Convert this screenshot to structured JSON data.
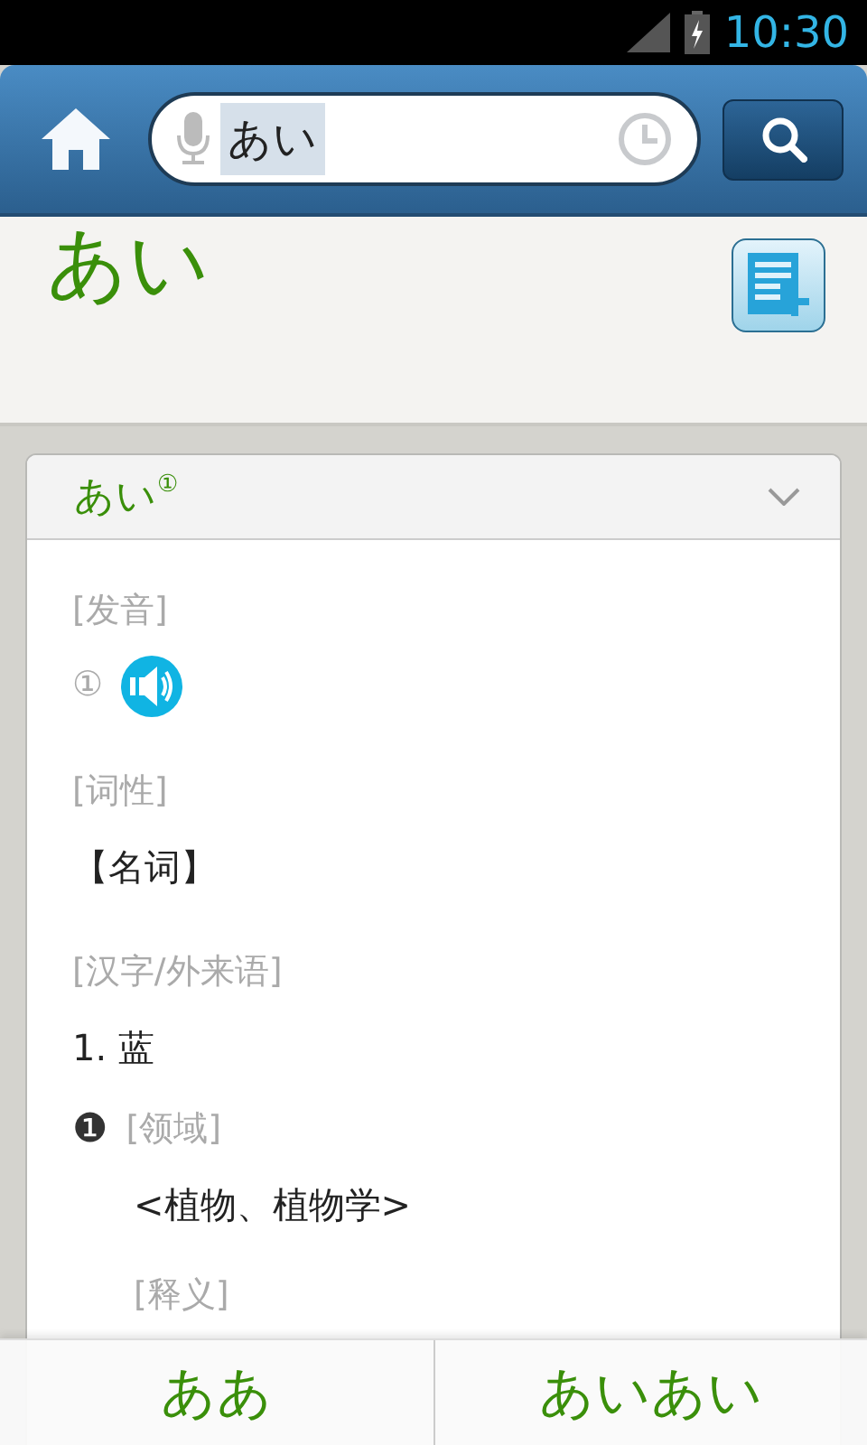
{
  "status_bar": {
    "time": "10:30"
  },
  "toolbar": {
    "search": {
      "value": "あい",
      "selected": true
    }
  },
  "headword": "あい",
  "entry": {
    "title": "あい$^{①}$",
    "expanded": true,
    "rows": [
      {
        "kind": "label",
        "text": "[发音]"
      },
      {
        "kind": "audio",
        "number": "①"
      },
      {
        "kind": "label",
        "text": "[词性]"
      },
      {
        "kind": "text",
        "text": "【名词】"
      },
      {
        "kind": "label",
        "text": "[汉字/外来语]"
      },
      {
        "kind": "text",
        "text": "1. 蓝"
      },
      {
        "kind": "sense",
        "number": "❶",
        "text": "[领域]"
      },
      {
        "kind": "subtext",
        "text": "<植物、植物学>"
      },
      {
        "kind": "sublabel",
        "text": "[释义]"
      }
    ]
  },
  "bottom_bar": [
    {
      "label": "ああ"
    },
    {
      "label": "あいあい"
    }
  ]
}
